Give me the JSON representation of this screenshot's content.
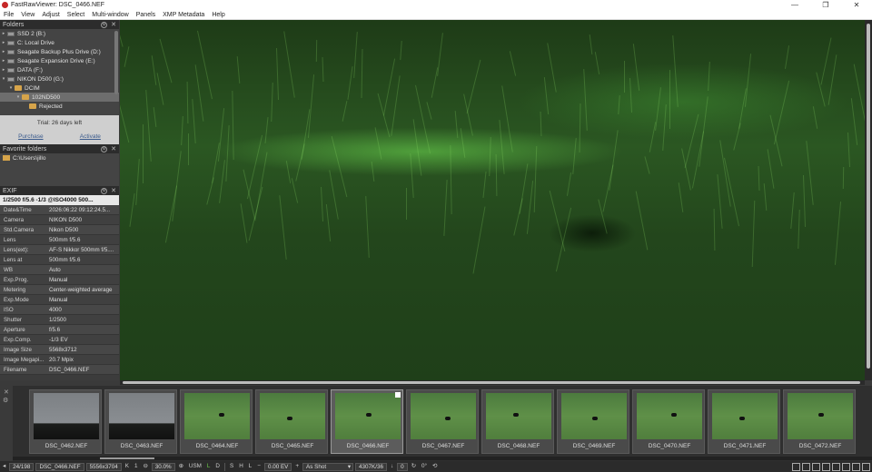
{
  "window": {
    "title": "FastRawViewer: DSC_0466.NEF",
    "minimize": "—",
    "maximize": "❐",
    "close": "✕"
  },
  "menu": [
    "File",
    "View",
    "Adjust",
    "Select",
    "Multi-window",
    "Panels",
    "XMP Metadata",
    "Help"
  ],
  "folders": {
    "title": "Folders",
    "items": [
      {
        "label": "SSD 2 (B:)",
        "kind": "drive",
        "arrow": "▸"
      },
      {
        "label": "C: Local Drive",
        "kind": "drive",
        "arrow": "▸"
      },
      {
        "label": "Seagate Backup Plus Drive (D:)",
        "kind": "drive",
        "arrow": "▸"
      },
      {
        "label": "Seagate Expansion Drive (E:)",
        "kind": "drive",
        "arrow": "▸"
      },
      {
        "label": "DATA (F:)",
        "kind": "drive",
        "arrow": "▸"
      },
      {
        "label": "NIKON D500 (G:)",
        "kind": "drive",
        "arrow": "▾"
      },
      {
        "label": "DCIM",
        "kind": "folder",
        "arrow": "▾"
      },
      {
        "label": "102ND500",
        "kind": "folder",
        "arrow": "▾",
        "selected": true
      },
      {
        "label": "Rejected",
        "kind": "folder",
        "arrow": ""
      }
    ]
  },
  "trial": {
    "text": "Trial: 26 days left",
    "purchase": "Purchase",
    "activate": "Activate"
  },
  "favorites": {
    "title": "Favorite folders",
    "items": [
      "C:\\Users\\jillo"
    ]
  },
  "exif": {
    "title": "EXIF",
    "summary": "1/2500 f/5.6 -1/3 @ISO4000 500...",
    "rows": [
      {
        "key": "Date&Time",
        "value": "2026:06:22 09:12:24.5..."
      },
      {
        "key": "Camera",
        "value": "NIKON D500"
      },
      {
        "key": "Std.Camera",
        "value": "Nikon D500"
      },
      {
        "key": "Lens",
        "value": "500mm f/5.6"
      },
      {
        "key": "Lens(ext):",
        "value": "AF-S Nikkor 500mm f/5...."
      },
      {
        "key": "Lens at",
        "value": "500mm f/5.6"
      },
      {
        "key": "WB",
        "value": "Auto"
      },
      {
        "key": "Exp.Prog.",
        "value": "Manual"
      },
      {
        "key": "Metering",
        "value": "Center-weighted average"
      },
      {
        "key": "Exp.Mode",
        "value": "Manual"
      },
      {
        "key": "ISO",
        "value": "4000"
      },
      {
        "key": "Shutter",
        "value": "1/2500"
      },
      {
        "key": "Aperture",
        "value": "f/5.6"
      },
      {
        "key": "Exp.Comp.",
        "value": "-1/3 EV"
      },
      {
        "key": "Image Size",
        "value": "5568x3712"
      },
      {
        "key": "Image Megapi...",
        "value": "20.7 Mpix"
      },
      {
        "key": "Filename",
        "value": "DSC_0466.NEF"
      }
    ]
  },
  "filmstrip": {
    "items": [
      {
        "name": "DSC_0462.NEF",
        "type": "gray"
      },
      {
        "name": "DSC_0463.NEF",
        "type": "gray"
      },
      {
        "name": "DSC_0464.NEF",
        "type": "green"
      },
      {
        "name": "DSC_0465.NEF",
        "type": "green"
      },
      {
        "name": "DSC_0466.NEF",
        "type": "green",
        "active": true
      },
      {
        "name": "DSC_0467.NEF",
        "type": "green"
      },
      {
        "name": "DSC_0468.NEF",
        "type": "green"
      },
      {
        "name": "DSC_0469.NEF",
        "type": "green"
      },
      {
        "name": "DSC_0470.NEF",
        "type": "green"
      },
      {
        "name": "DSC_0471.NEF",
        "type": "green"
      },
      {
        "name": "DSC_0472.NEF",
        "type": "green"
      }
    ]
  },
  "statusbar": {
    "prev": "◂",
    "position": "24/198",
    "filename": "DSC_0466.NEF",
    "dimensions": "5556x3704",
    "btn_k": "K",
    "btn_1": "1",
    "zoom_out": "⊖",
    "zoom": "30.0%",
    "zoom_in": "⊕",
    "usm": "USM",
    "btn_l": "L",
    "btn_d": "D",
    "btn_s": "S",
    "btn_h": "H",
    "btn_l2": "L",
    "ev_minus": "−",
    "ev": "0.00 EV",
    "ev_plus": "+",
    "wb": "As Shot",
    "wb_arrow": "▾",
    "temp": "4307K/36",
    "rating_arrow": "↓",
    "rating": "0",
    "rotate_icon": "↻",
    "rotation": "0°",
    "crop_icon": "⟲"
  },
  "colors": {
    "accent_green": "#6fd04a",
    "folder": "#d6a44a",
    "link": "#3a5a8c"
  }
}
